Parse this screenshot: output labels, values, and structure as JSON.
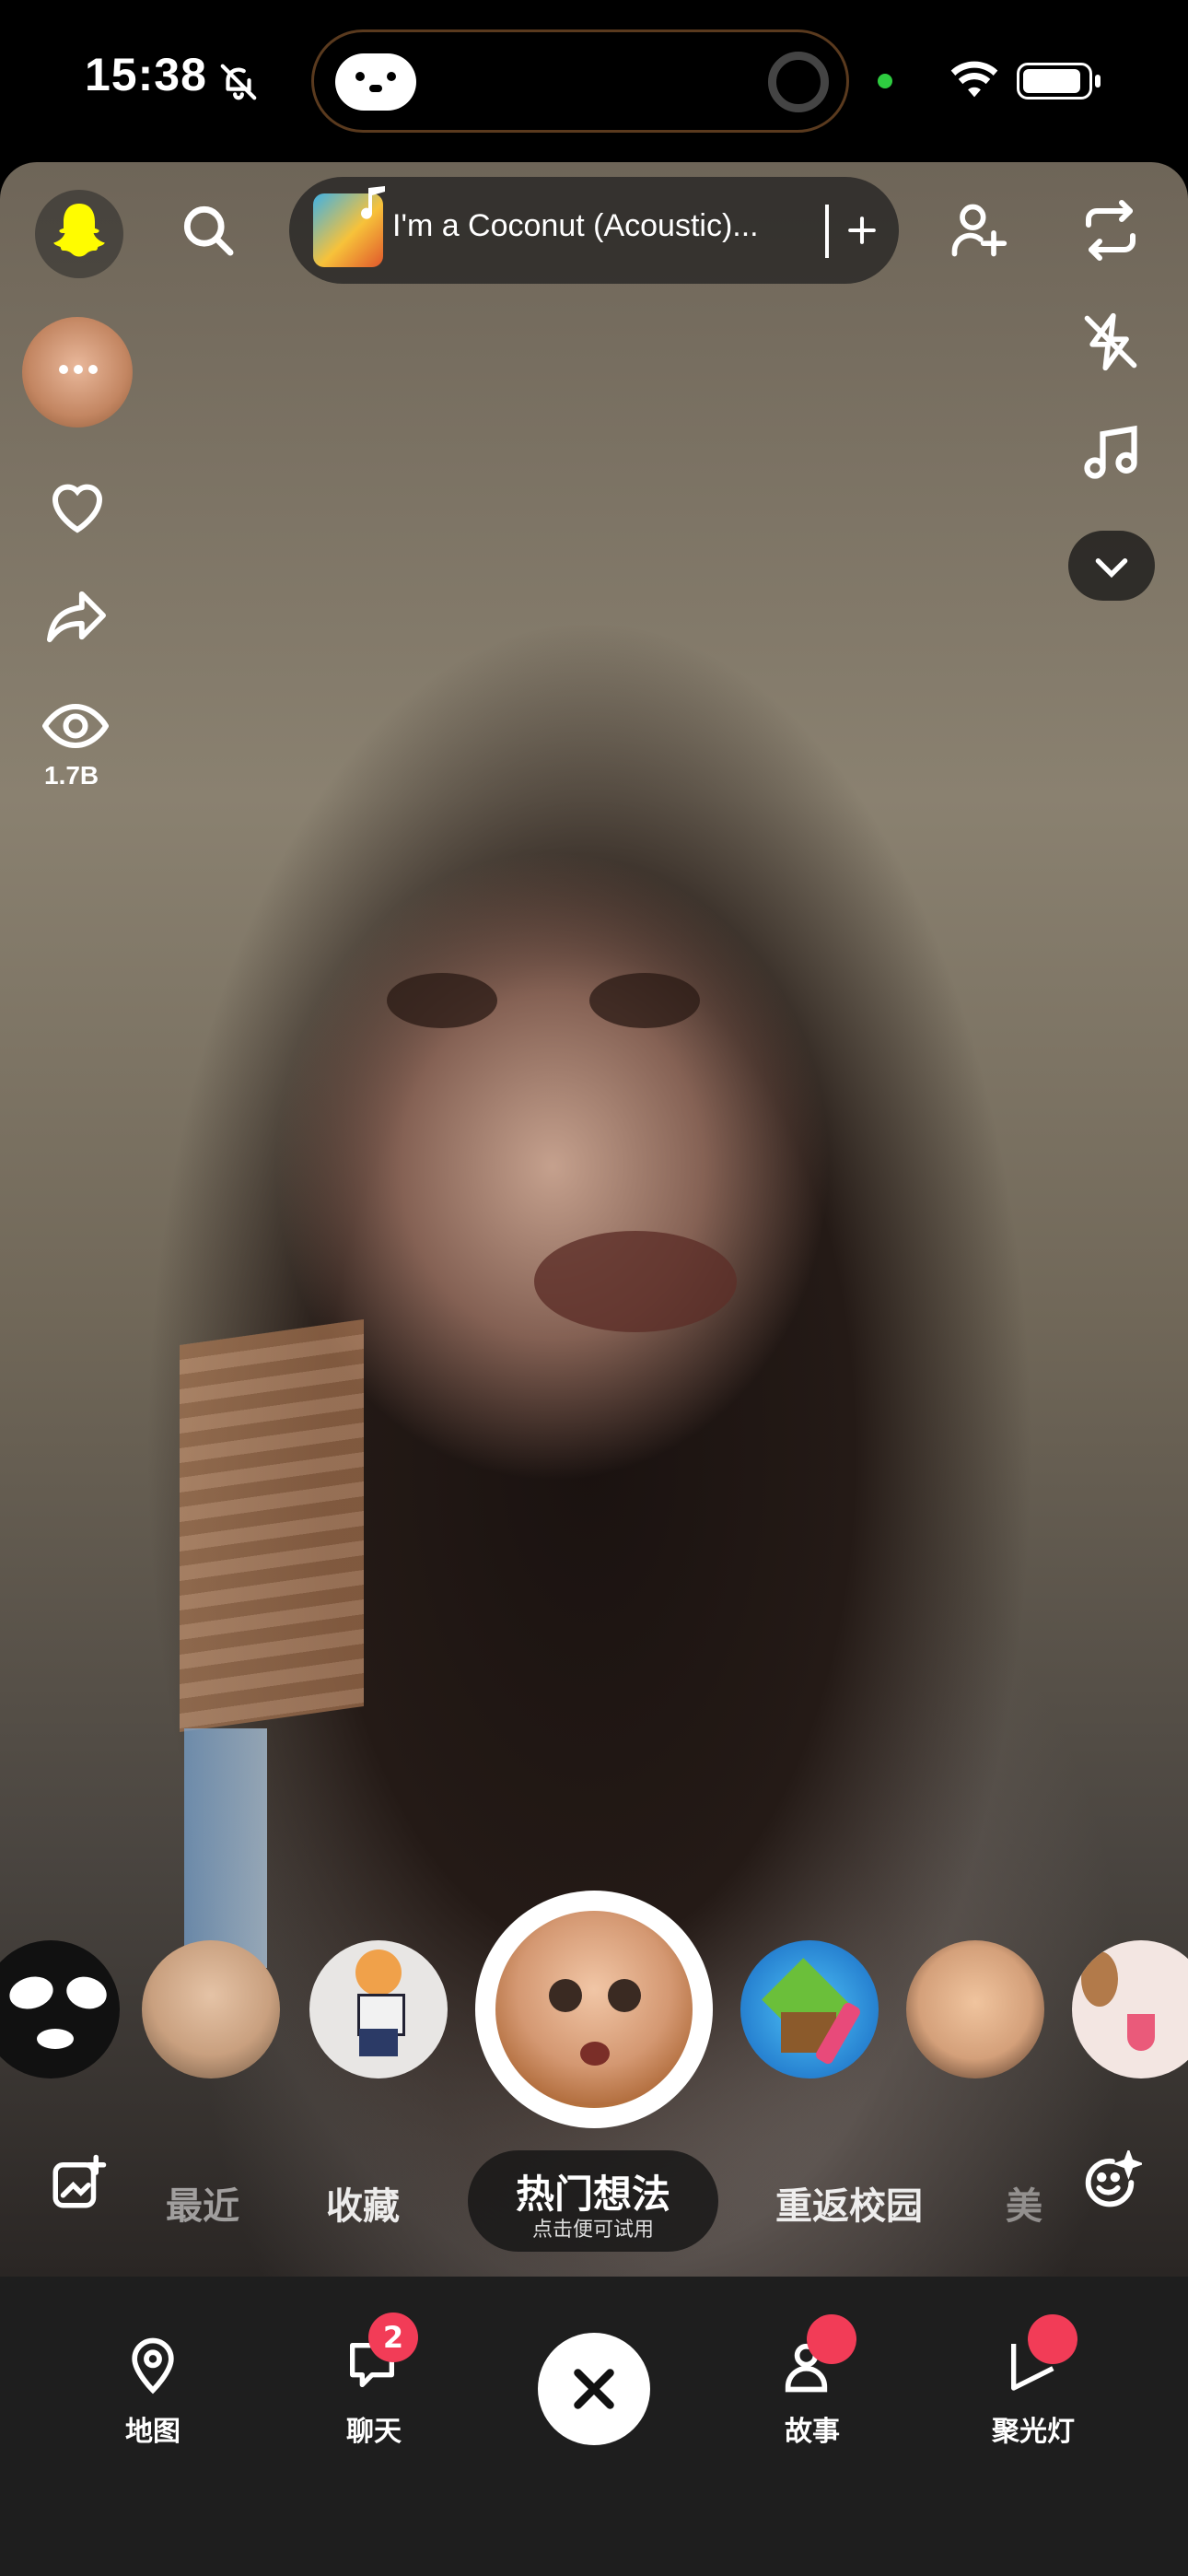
{
  "status_bar": {
    "time": "15:38",
    "icons": [
      "bell-slash-icon",
      "camera-icon",
      "wifi-icon",
      "battery-icon"
    ]
  },
  "top_bar": {
    "music_title": "I'm a Coconut (Acoustic)...",
    "icons": [
      "profile-icon",
      "search-icon",
      "add-friend-icon",
      "flip-camera-icon"
    ]
  },
  "right_toolbar": {
    "icons": [
      "flash-off-icon",
      "music-icon",
      "chevron-down-icon"
    ]
  },
  "left_toolbar": {
    "icons": [
      "lens-avatar",
      "heart-icon",
      "share-icon",
      "eye-icon"
    ],
    "views_count": "1.7B"
  },
  "lens_carousel": {
    "items": [
      "mask-lens",
      "beauty-lens",
      "anime-girl-lens",
      "cartoon-face-lens (selected)",
      "minecraft-lens",
      "cartoon-girl-lens",
      "dog-lens"
    ]
  },
  "categories": {
    "items": [
      "最近",
      "收藏",
      "重返校园",
      "美"
    ],
    "active_title": "热门想法",
    "active_subtitle": "点击便可试用"
  },
  "bottom_nav": {
    "items": [
      {
        "label": "地图",
        "icon": "map-pin-icon"
      },
      {
        "label": "聊天",
        "icon": "chat-icon",
        "badge": "2"
      },
      {
        "label": "故事",
        "icon": "stories-icon"
      },
      {
        "label": "聚光灯",
        "icon": "spotlight-icon"
      }
    ],
    "close_icon": "close-icon"
  },
  "colors": {
    "badge": "#f23c57",
    "snap_yellow": "#fffc00"
  }
}
